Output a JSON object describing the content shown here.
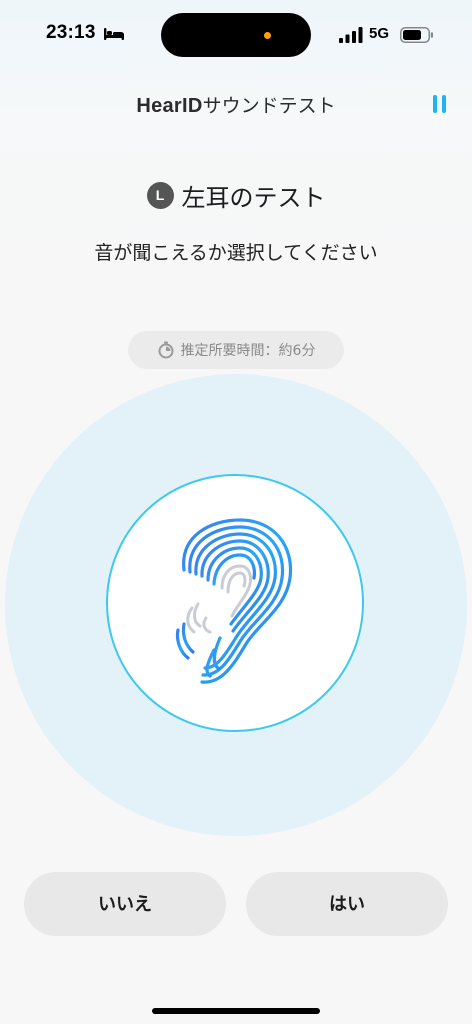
{
  "status_bar": {
    "time": "23:13",
    "network": "5G",
    "icons": [
      "bed-icon",
      "signal-icon",
      "battery-icon"
    ]
  },
  "header": {
    "brand": "HearID",
    "title_rest": "サウンドテスト",
    "pause_icon": "pause-icon"
  },
  "test": {
    "ear_badge": "L",
    "title": "左耳のテスト",
    "instruction": "音が聞こえるか選択してください",
    "estimated_time": "推定所要時間：約6分"
  },
  "buttons": {
    "no_label": "いいえ",
    "yes_label": "はい"
  },
  "colors": {
    "accent": "#1fb4ee",
    "ring": "#3ec8ef",
    "outer_circle": "#e3f2f8",
    "button_bg": "#e8e8e8"
  }
}
